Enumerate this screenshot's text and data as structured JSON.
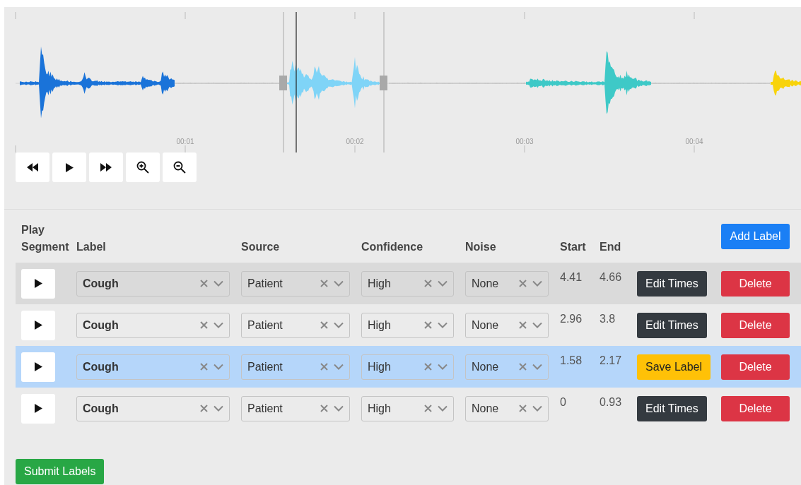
{
  "timeline": {
    "labels": [
      "00:01",
      "00:02",
      "00:03",
      "00:04"
    ]
  },
  "transport": [
    {
      "kind": "rewind"
    },
    {
      "kind": "play"
    },
    {
      "kind": "forward"
    },
    {
      "kind": "zoom-in"
    },
    {
      "kind": "zoom-out"
    }
  ],
  "table": {
    "columns": [
      "Play Segment",
      "Label",
      "Source",
      "Confidence",
      "Noise",
      "Start",
      "End"
    ],
    "add_button": "Add Label",
    "rows": [
      {
        "hovered": true,
        "selected": false,
        "label": "Cough",
        "source": "Patient",
        "confidence": "High",
        "noise": "None",
        "start": "4.41",
        "end": "4.66",
        "action": {
          "kind": "edit",
          "label": "Edit Times"
        },
        "delete": "Delete"
      },
      {
        "hovered": false,
        "selected": false,
        "label": "Cough",
        "source": "Patient",
        "confidence": "High",
        "noise": "None",
        "start": "2.96",
        "end": "3.8",
        "action": {
          "kind": "edit",
          "label": "Edit Times"
        },
        "delete": "Delete"
      },
      {
        "hovered": false,
        "selected": true,
        "label": "Cough",
        "source": "Patient",
        "confidence": "High",
        "noise": "None",
        "start": "1.58",
        "end": "2.17",
        "action": {
          "kind": "save",
          "label": "Save Label"
        },
        "delete": "Delete"
      },
      {
        "hovered": false,
        "selected": false,
        "label": "Cough",
        "source": "Patient",
        "confidence": "High",
        "noise": "None",
        "start": "0",
        "end": "0.93",
        "action": {
          "kind": "edit",
          "label": "Edit Times"
        },
        "delete": "Delete"
      }
    ]
  },
  "submit_button": "Submit Labels"
}
